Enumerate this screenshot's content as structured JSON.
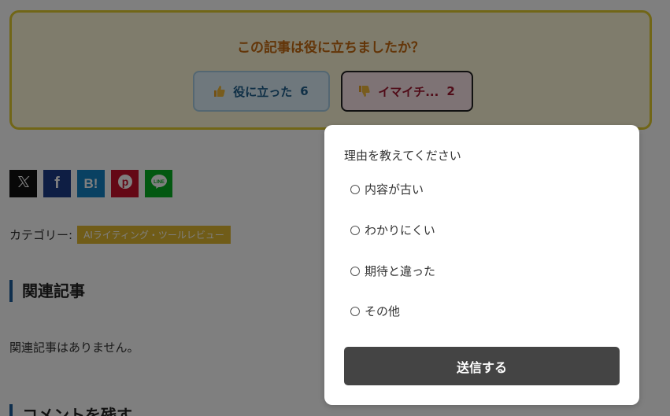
{
  "feedback": {
    "question": "この記事は役に立ちましたか？",
    "good_button": {
      "label": "役に立った",
      "count": "6",
      "icon": "thumbs-up-icon"
    },
    "bad_button": {
      "label": "イマイチ...",
      "count": "2",
      "icon": "thumbs-down-icon"
    }
  },
  "share": {
    "buttons": [
      {
        "name": "x",
        "icon": "x-logo-icon",
        "color": "#111111"
      },
      {
        "name": "facebook",
        "icon": "facebook-icon",
        "color": "#1d3d88"
      },
      {
        "name": "hatena",
        "icon": "hatena-bookmark-icon",
        "color": "#1383c4"
      },
      {
        "name": "pinterest",
        "icon": "pinterest-icon",
        "color": "#c8112a"
      },
      {
        "name": "line",
        "icon": "line-icon",
        "color": "#06b022"
      }
    ]
  },
  "category": {
    "label": "カテゴリー:",
    "tag": "AIライティング・ツールレビュー"
  },
  "related": {
    "heading": "関連記事",
    "empty_text": "関連記事はありません。"
  },
  "comments": {
    "heading": "コメントを残す"
  },
  "popup": {
    "title": "理由を教えてください",
    "reasons": [
      "内容が古い",
      "わかりにくい",
      "期待と違った",
      "その他"
    ],
    "submit_label": "送信する"
  },
  "colors": {
    "feedback_border": "#e3cd2f",
    "question_text": "#c76a10",
    "good_text": "#1e5f8c",
    "bad_text": "#a01830",
    "submit_bg": "#444444",
    "heading_bar": "#1f5e9c",
    "category_tag_bg": "#e0b830"
  }
}
